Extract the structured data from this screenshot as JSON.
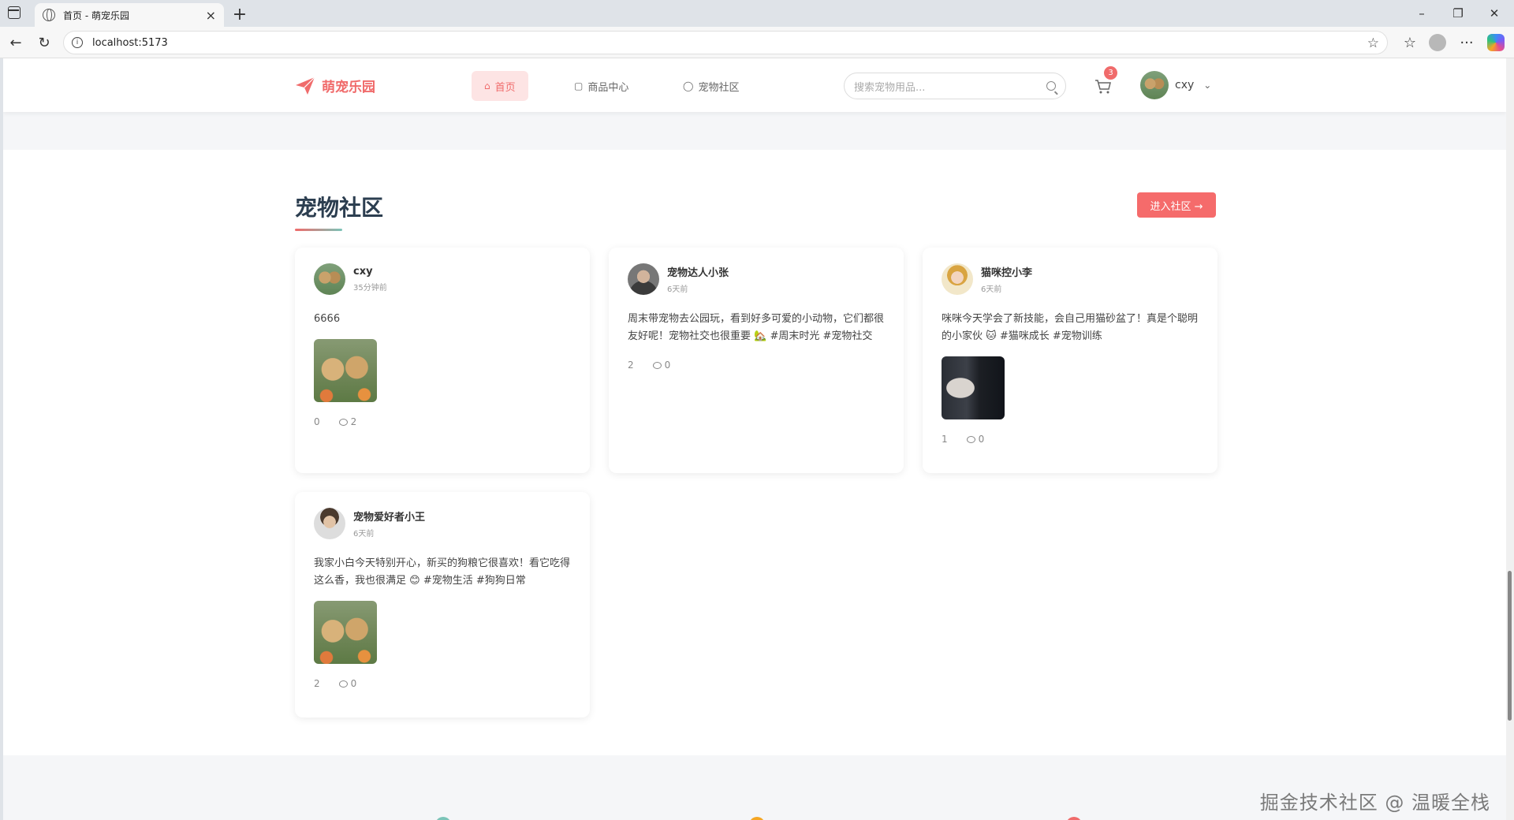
{
  "browser": {
    "tab_title": "首页 - 萌宠乐园",
    "url": "localhost:5173"
  },
  "header": {
    "logo_text": "萌宠乐园",
    "nav": [
      {
        "label": "首页",
        "icon": "home-icon",
        "active": true
      },
      {
        "label": "商品中心",
        "icon": "shop-icon",
        "active": false
      },
      {
        "label": "宠物社区",
        "icon": "chat-icon",
        "active": false
      }
    ],
    "search_placeholder": "搜索宠物用品...",
    "cart_count": "3",
    "username": "cxy"
  },
  "community": {
    "title": "宠物社区",
    "enter_button": "进入社区 →",
    "posts": [
      {
        "author": "cxy",
        "time": "35分钟前",
        "content": "6666",
        "image": "dogs-photo",
        "likes": "0",
        "comments": "2"
      },
      {
        "author": "宠物达人小张",
        "time": "6天前",
        "content": "周末带宠物去公园玩，看到好多可爱的小动物，它们都很友好呢！宠物社交也很重要 🏡 #周末时光 #宠物社交",
        "image": null,
        "likes": "2",
        "comments": "0"
      },
      {
        "author": "猫咪控小李",
        "time": "6天前",
        "content": "咪咪今天学会了新技能，会自己用猫砂盆了！真是个聪明的小家伙 🐱 #猫咪成长 #宠物训练",
        "image": "cat-photo",
        "likes": "1",
        "comments": "0"
      },
      {
        "author": "宠物爱好者小王",
        "time": "6天前",
        "content": "我家小白今天特别开心，新买的狗粮它很喜欢！看它吃得这么香，我也很满足 😊 #宠物生活 #狗狗日常",
        "image": "dogs-photo",
        "likes": "2",
        "comments": "0"
      }
    ]
  },
  "watermark": "掘金技术社区 @ 温暖全栈",
  "colors": {
    "brand": "#f06b6b",
    "accent": "#7bc4b8",
    "title": "#2c3e50"
  }
}
